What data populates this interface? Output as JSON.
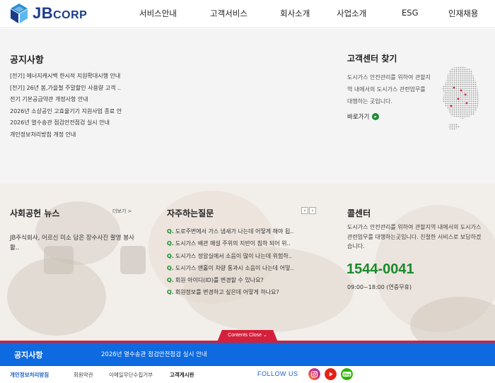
{
  "header": {
    "logo_jb": "JB",
    "logo_corp": "CORP",
    "nav": [
      "서비스안내",
      "고객서비스",
      "회사소개",
      "사업소개",
      "ESG",
      "인재채용"
    ]
  },
  "notice": {
    "title": "공지사항",
    "items": [
      "[전기] 에너지캐시백 한시적 지원확대시행 안내",
      "[전기] 26년 봄,가을철 주말할인 사용량 고객 ..",
      "전기 기본공급약관 개정사항 안내",
      "2026년 소상공인 고효율기기 지원사업 종료 안",
      "2026년 열수송관 점검안전점검 실시 안내",
      "개인정보처리방침 개정 안내"
    ]
  },
  "customer_center": {
    "title": "고객센터 찾기",
    "desc": "도시가스 안전관리를 위하여 관할지역 내에서의 도시가스 관련업무를 대행하는 곳입니다.",
    "link": "바로가기",
    "link_icon": "chevron-right-icon"
  },
  "social": {
    "title": "사회공헌 뉴스",
    "more": "더보기 >",
    "news": "JB주식회사, 어르신 미소 담은 장수사진 촬영 봉사활.."
  },
  "faq": {
    "title": "자주하는질문",
    "prev": "‹",
    "next": "›",
    "q_mark": "Q.",
    "items": [
      "도로주변에서 가스 냄새가 나는데 어떻게 해야 됩..",
      "도시가스 배관 매설 주위의 지반이 침하 되어 위..",
      "도시가스 정압실에서 소음이 많이 나는데 위험하..",
      "도시가스 맨홀이 차량 통과시 소음이 나는데 어떻..",
      "회원 아이디(ID)를 변경할 수 있나요?",
      "회원정보를 변경하고 싶은데 어떻게 하나요?"
    ]
  },
  "call_center": {
    "title": "콜센터",
    "desc": "도시가스 안전관리를 위하여 관할지역 내에서의 도시가스 관련업무를 대행하는곳입니다. 친절한 서비스로 보답하겠습니다.",
    "number": "1544-0041",
    "hours": "09:00~18:00 (연중무휴)"
  },
  "contents_close": "Contents Close ⌄",
  "notice_bar": {
    "title": "공지사항",
    "text": "2026년 열수송관 점검안전점검 실시 안내"
  },
  "footer": {
    "links": [
      "개인정보처리방침",
      "회원약관",
      "이메일무단수집거부",
      "고객게시판"
    ],
    "follow": "FOLLOW US",
    "sns": [
      "instagram-icon",
      "youtube-icon",
      "blog-icon"
    ],
    "blog_label": "Blog"
  },
  "colors": {
    "brand_blue": "#1b3a8a",
    "accent_green": "#1a8a2c",
    "notice_bar_blue": "#0d6ae0",
    "close_red": "#d3203b"
  }
}
